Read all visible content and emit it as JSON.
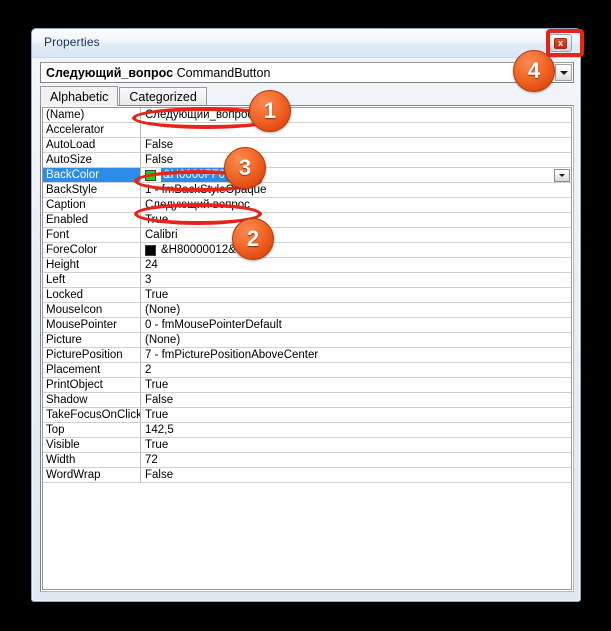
{
  "window": {
    "title": "Properties",
    "close_label": "x"
  },
  "object_selector": {
    "name": "Следующий_вопрос",
    "type": "CommandButton",
    "arrow_icon": "chevron-down-icon"
  },
  "tabs": [
    {
      "label": "Alphabetic",
      "active": true
    },
    {
      "label": "Categorized",
      "active": false
    }
  ],
  "grid": {
    "rows": [
      {
        "name": "(Name)",
        "value": "Следующий_вопрос"
      },
      {
        "name": "Accelerator",
        "value": ""
      },
      {
        "name": "AutoLoad",
        "value": "False"
      },
      {
        "name": "AutoSize",
        "value": "False"
      },
      {
        "name": "BackColor",
        "value": "&H0000FF00&",
        "selected": true,
        "swatch": "#00e400",
        "value_selected": true,
        "dropdown": true
      },
      {
        "name": "BackStyle",
        "value": "1 - fmBackStyleOpaque"
      },
      {
        "name": "Caption",
        "value": "Следующий вопрос"
      },
      {
        "name": "Enabled",
        "value": "True"
      },
      {
        "name": "Font",
        "value": "Calibri"
      },
      {
        "name": "ForeColor",
        "value": "&H80000012&",
        "swatch": "#000000"
      },
      {
        "name": "Height",
        "value": "24"
      },
      {
        "name": "Left",
        "value": "3"
      },
      {
        "name": "Locked",
        "value": "True"
      },
      {
        "name": "MouseIcon",
        "value": "(None)"
      },
      {
        "name": "MousePointer",
        "value": "0 - fmMousePointerDefault"
      },
      {
        "name": "Picture",
        "value": "(None)"
      },
      {
        "name": "PicturePosition",
        "value": "7 - fmPicturePositionAboveCenter"
      },
      {
        "name": "Placement",
        "value": "2"
      },
      {
        "name": "PrintObject",
        "value": "True"
      },
      {
        "name": "Shadow",
        "value": "False"
      },
      {
        "name": "TakeFocusOnClick",
        "value": "True"
      },
      {
        "name": "Top",
        "value": "142,5"
      },
      {
        "name": "Visible",
        "value": "True"
      },
      {
        "name": "Width",
        "value": "72"
      },
      {
        "name": "WordWrap",
        "value": "False"
      }
    ]
  },
  "annotations": {
    "accent_color": "#e8241a",
    "callouts": [
      {
        "number": "1"
      },
      {
        "number": "2"
      },
      {
        "number": "3"
      },
      {
        "number": "4"
      }
    ]
  }
}
